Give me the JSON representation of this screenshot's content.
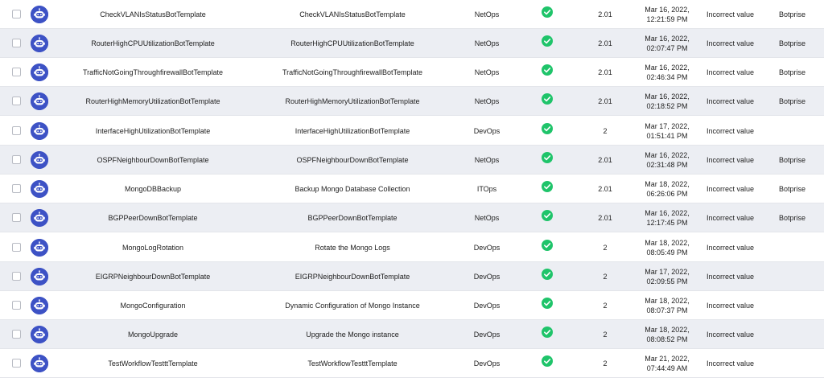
{
  "rows": [
    {
      "name": "CheckVLANIsStatusBotTemplate",
      "description": "CheckVLANIsStatusBotTemplate",
      "group": "NetOps",
      "version": "2.01",
      "date": "Mar 16, 2022,",
      "time": "12:21:59 PM",
      "validation": "Incorrect value",
      "owner": "Botprise"
    },
    {
      "name": "RouterHighCPUUtilizationBotTemplate",
      "description": "RouterHighCPUUtilizationBotTemplate",
      "group": "NetOps",
      "version": "2.01",
      "date": "Mar 16, 2022,",
      "time": "02:07:47 PM",
      "validation": "Incorrect value",
      "owner": "Botprise"
    },
    {
      "name": "TrafficNotGoingThroughfirewallBotTemplate",
      "description": "TrafficNotGoingThroughfirewallBotTemplate",
      "group": "NetOps",
      "version": "2.01",
      "date": "Mar 16, 2022,",
      "time": "02:46:34 PM",
      "validation": "Incorrect value",
      "owner": "Botprise"
    },
    {
      "name": "RouterHighMemoryUtilizationBotTemplate",
      "description": "RouterHighMemoryUtilizationBotTemplate",
      "group": "NetOps",
      "version": "2.01",
      "date": "Mar 16, 2022,",
      "time": "02:18:52 PM",
      "validation": "Incorrect value",
      "owner": "Botprise"
    },
    {
      "name": "InterfaceHighUtilizationBotTemplate",
      "description": "InterfaceHighUtilizationBotTemplate",
      "group": "DevOps",
      "version": "2",
      "date": "Mar 17, 2022,",
      "time": "01:51:41 PM",
      "validation": "Incorrect value",
      "owner": ""
    },
    {
      "name": "OSPFNeighbourDownBotTemplate",
      "description": "OSPFNeighbourDownBotTemplate",
      "group": "NetOps",
      "version": "2.01",
      "date": "Mar 16, 2022,",
      "time": "02:31:48 PM",
      "validation": "Incorrect value",
      "owner": "Botprise"
    },
    {
      "name": "MongoDBBackup",
      "description": "Backup Mongo Database Collection",
      "group": "ITOps",
      "version": "2.01",
      "date": "Mar 18, 2022,",
      "time": "06:26:06 PM",
      "validation": "Incorrect value",
      "owner": "Botprise"
    },
    {
      "name": "BGPPeerDownBotTemplate",
      "description": "BGPPeerDownBotTemplate",
      "group": "NetOps",
      "version": "2.01",
      "date": "Mar 16, 2022,",
      "time": "12:17:45 PM",
      "validation": "Incorrect value",
      "owner": "Botprise"
    },
    {
      "name": "MongoLogRotation",
      "description": "Rotate the Mongo Logs",
      "group": "DevOps",
      "version": "2",
      "date": "Mar 18, 2022,",
      "time": "08:05:49 PM",
      "validation": "Incorrect value",
      "owner": ""
    },
    {
      "name": "EIGRPNeighbourDownBotTemplate",
      "description": "EIGRPNeighbourDownBotTemplate",
      "group": "DevOps",
      "version": "2",
      "date": "Mar 17, 2022,",
      "time": "02:09:55 PM",
      "validation": "Incorrect value",
      "owner": ""
    },
    {
      "name": "MongoConfiguration",
      "description": "Dynamic Configuration of Mongo Instance",
      "group": "DevOps",
      "version": "2",
      "date": "Mar 18, 2022,",
      "time": "08:07:37 PM",
      "validation": "Incorrect value",
      "owner": ""
    },
    {
      "name": "MongoUpgrade",
      "description": "Upgrade the Mongo instance",
      "group": "DevOps",
      "version": "2",
      "date": "Mar 18, 2022,",
      "time": "08:08:52 PM",
      "validation": "Incorrect value",
      "owner": ""
    },
    {
      "name": "TestWorkflowTestttTemplate",
      "description": "TestWorkflowTestttTemplate",
      "group": "DevOps",
      "version": "2",
      "date": "Mar 21, 2022,",
      "time": "07:44:49 AM",
      "validation": "Incorrect value",
      "owner": ""
    }
  ],
  "icons": {
    "avatar": "bot-avatar-icon",
    "status": "check-circle-icon"
  },
  "colors": {
    "avatar": "#3d52c5",
    "status_ok": "#1fc46a",
    "row_alt": "#eceef3"
  }
}
